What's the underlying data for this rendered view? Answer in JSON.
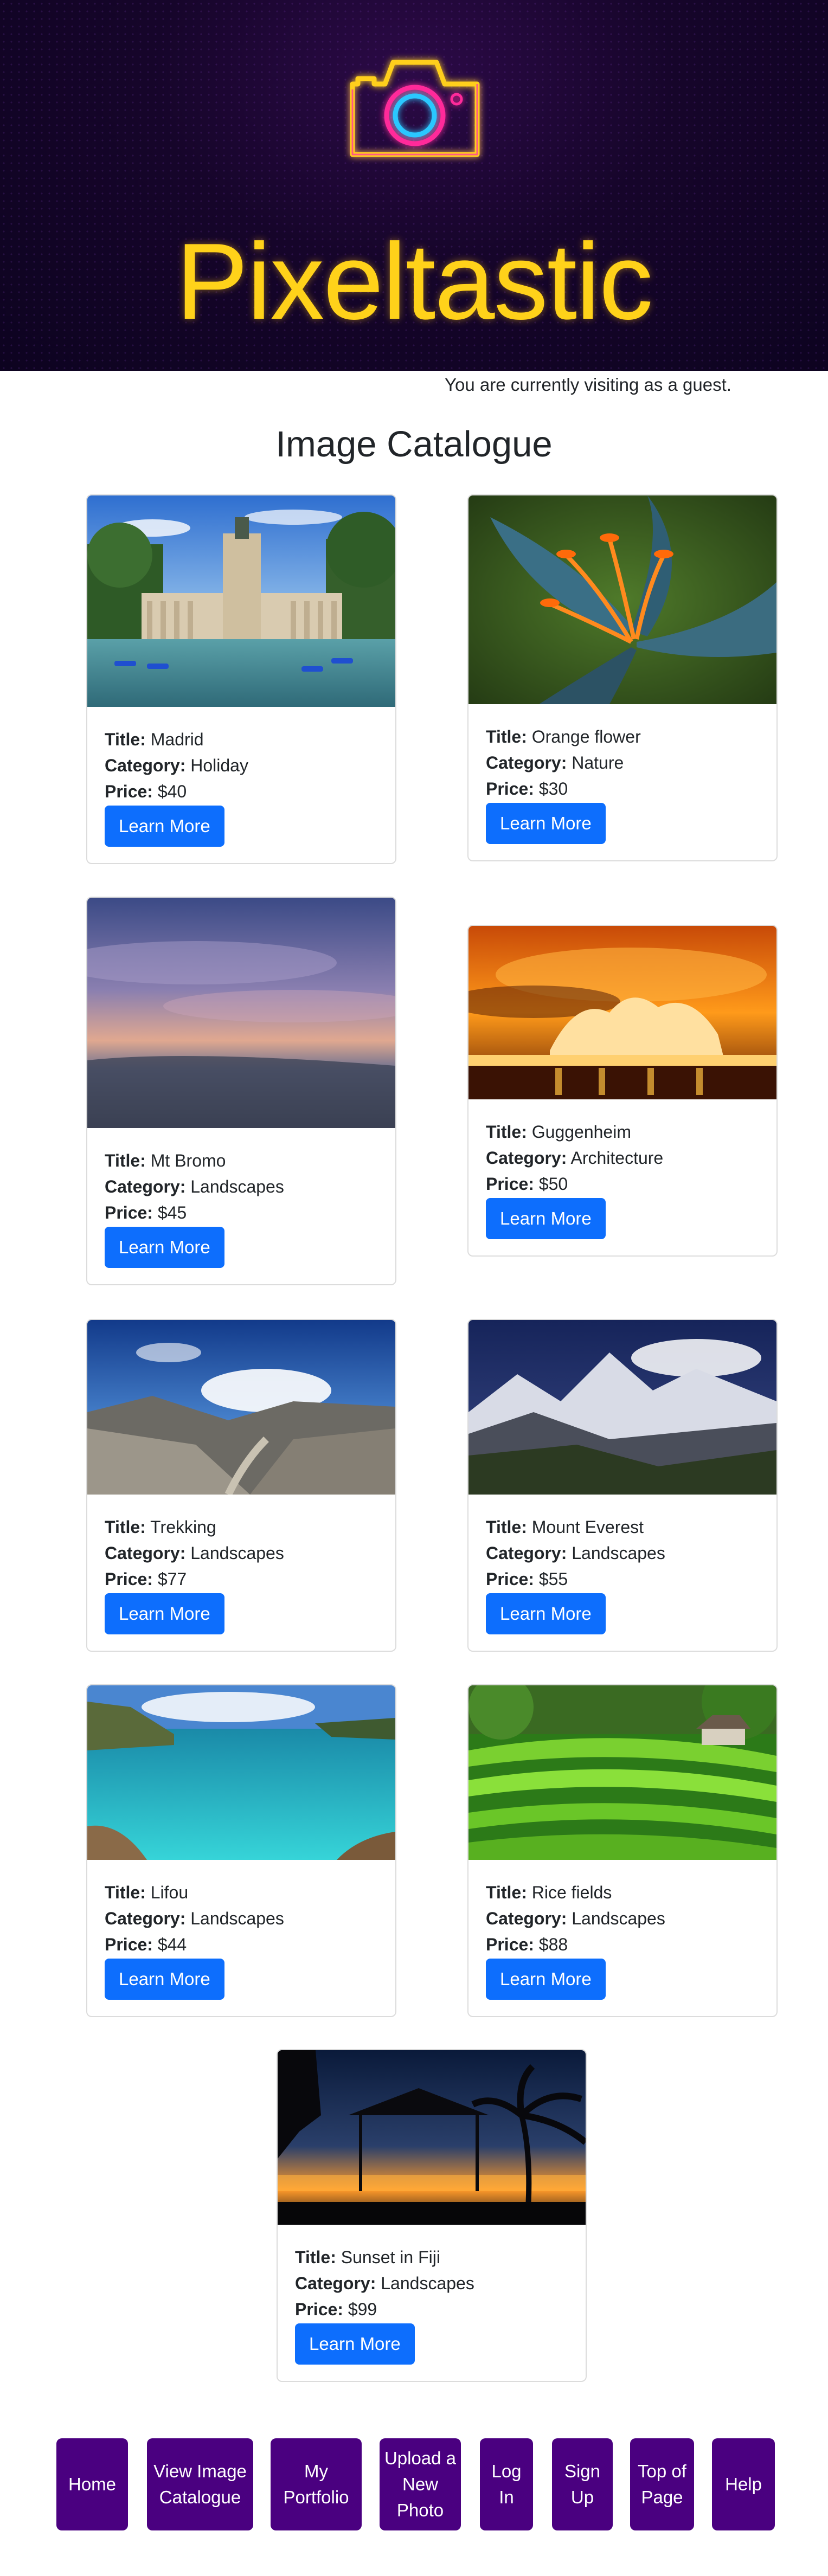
{
  "header": {
    "logo_icon": "neon-camera-icon",
    "brand": "Pixeltastic",
    "colors": {
      "brand_text": "#ffd21a",
      "hero_bg": "#16052a"
    }
  },
  "status": {
    "guest_message": "You are currently visiting as a guest."
  },
  "catalogue": {
    "heading": "Image Catalogue",
    "labels": {
      "title": "Title:",
      "category": "Category:",
      "price": "Price:"
    },
    "button_label": "Learn More",
    "items": [
      {
        "title": "Madrid",
        "category": "Holiday",
        "price": "$40"
      },
      {
        "title": "Orange flower",
        "category": "Nature",
        "price": "$30"
      },
      {
        "title": "Mt Bromo",
        "category": "Landscapes",
        "price": "$45"
      },
      {
        "title": "Guggenheim",
        "category": "Architecture",
        "price": "$50"
      },
      {
        "title": "Trekking",
        "category": "Landscapes",
        "price": "$77"
      },
      {
        "title": "Mount Everest",
        "category": "Landscapes",
        "price": "$55"
      },
      {
        "title": "Lifou",
        "category": "Landscapes",
        "price": "$44"
      },
      {
        "title": "Rice fields",
        "category": "Landscapes",
        "price": "$88"
      },
      {
        "title": "Sunset in Fiji",
        "category": "Landscapes",
        "price": "$99"
      }
    ]
  },
  "footer_nav": [
    {
      "label": "Home"
    },
    {
      "label": "View Image Catalogue"
    },
    {
      "label": "My Portfolio"
    },
    {
      "label": "Upload a New Photo"
    },
    {
      "label": "Log In"
    },
    {
      "label": "Sign Up"
    },
    {
      "label": "Top of Page"
    },
    {
      "label": "Help"
    }
  ],
  "colors": {
    "button": "#0d6efd",
    "nav": "#4a0080"
  }
}
